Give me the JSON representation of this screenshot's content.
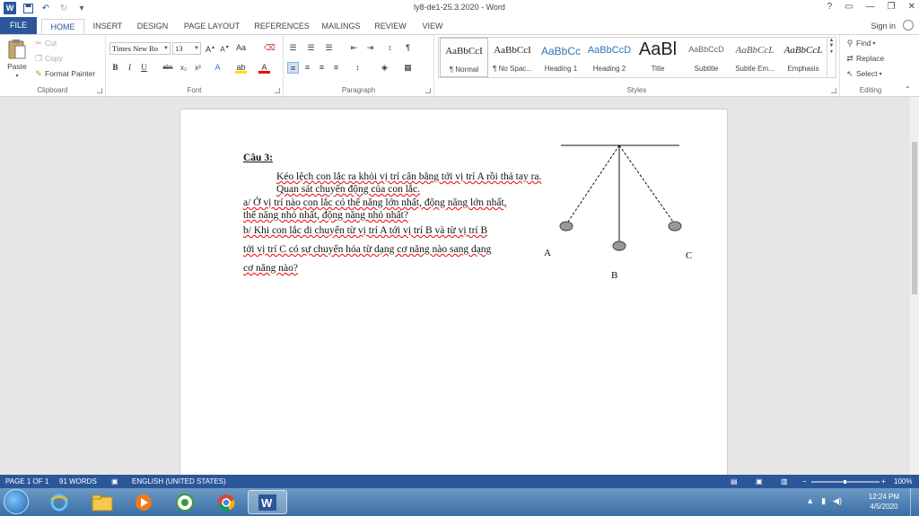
{
  "window": {
    "title": "ly8-de1-25.3.2020 - Word",
    "help": "?",
    "controls": [
      "▭",
      "—",
      "❐",
      "✕"
    ]
  },
  "qat": {
    "app_icon": "W",
    "save": "save-icon",
    "undo": "undo-icon",
    "redo": "redo-icon",
    "customize": "▾"
  },
  "tabs": [
    "FILE",
    "HOME",
    "INSERT",
    "DESIGN",
    "PAGE LAYOUT",
    "REFERENCES",
    "MAILINGS",
    "REVIEW",
    "VIEW"
  ],
  "signin": "Sign in",
  "ribbon": {
    "clipboard": {
      "label": "Clipboard",
      "paste": "Paste",
      "cut": "Cut",
      "copy": "Copy",
      "format_painter": "Format Painter"
    },
    "font": {
      "label": "Font",
      "font_name": "Times New Ro",
      "font_size": "13"
    },
    "paragraph": {
      "label": "Paragraph"
    },
    "styles": {
      "label": "Styles",
      "items": [
        {
          "preview": "AaBbCcI",
          "name": "¶ Normal"
        },
        {
          "preview": "AaBbCcI",
          "name": "¶ No Spac..."
        },
        {
          "preview": "AaBbCc",
          "name": "Heading 1"
        },
        {
          "preview": "AaBbCcD",
          "name": "Heading 2"
        },
        {
          "preview": "AaBl",
          "name": "Title"
        },
        {
          "preview": "AaBbCcD",
          "name": "Subtitle"
        },
        {
          "preview": "AaBbCcL",
          "name": "Subtle Em..."
        },
        {
          "preview": "AaBbCcL",
          "name": "Emphasis"
        }
      ]
    },
    "editing": {
      "label": "Editing",
      "find": "Find",
      "replace": "Replace",
      "select": "Select"
    }
  },
  "document": {
    "heading": "Câu 3:",
    "line1": "Kéo lệch con lắc ra khỏi vị trí cân bằng tới vị trí A rồi thả tay ra.",
    "line2": "Quan sát chuyển động của con lắc.",
    "line3": "a/ Ở vị trí nào con lắc có thế năng lớn nhất, động năng lớn nhất,",
    "line4": "thế năng nhỏ nhất, động năng nhỏ nhất?",
    "line5": "b/ Khi con lắc di chuyển từ vị trí A tới vị trí B và từ vị trí B",
    "line6": "tới  vị trí C có sự chuyển hóa từ dạng cơ năng nào sang dạng",
    "line7": "cơ năng nào?",
    "labels": {
      "a": "A",
      "b": "B",
      "c": "C"
    }
  },
  "statusbar": {
    "page": "PAGE 1 OF 1",
    "words": "91 WORDS",
    "language": "ENGLISH (UNITED STATES)",
    "zoom": "100%"
  },
  "taskbar": {
    "time": "12:24 PM",
    "date": "4/5/2020"
  }
}
